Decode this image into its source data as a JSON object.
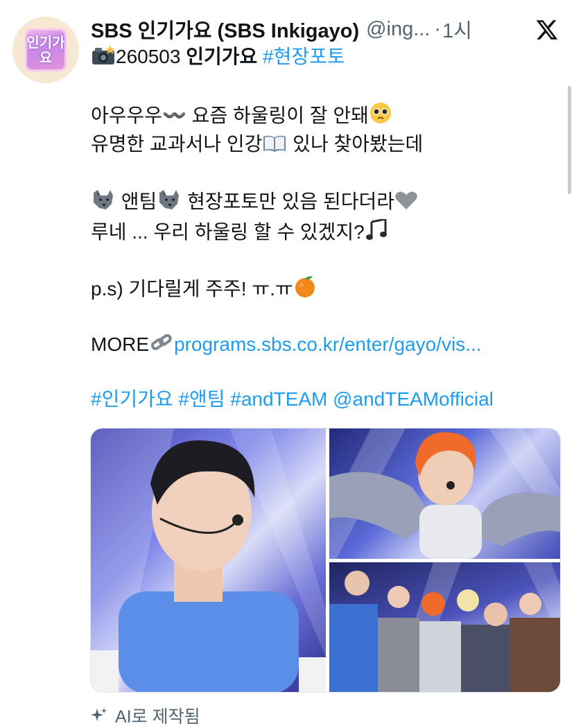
{
  "author": {
    "display_name": "SBS 인기가요 (SBS Inkigayo)",
    "handle": "@ing...",
    "separator": "·",
    "time": "1시",
    "avatar_text": "인기가요"
  },
  "tweet": {
    "line1_prefix": "260503 ",
    "line1_bold": "인기가요",
    "line1_hashtag": "#현장포토",
    "line2": "아우우우〰️ 요즘 하울링이 잘 안돼",
    "line3_a": "유명한 교과서나 인강",
    "line3_b": " 있나 찾아봤는데",
    "line4_a": " 앤팀",
    "line4_b": " 현장포토만 있음 된다더라",
    "line5": "루네 ... 우리 하울링 할 수 있겠지?",
    "line6": "p.s) 기다릴게 주주! ㅠ.ㅠ",
    "more_label": "MORE",
    "more_link": "programs.sbs.co.kr/enter/gayo/vis...",
    "tags": "#인기가요 #앤팀 #andTEAM @andTEAMofficial"
  },
  "footer": {
    "ai_label": "AI로 제작됨"
  },
  "icons": {
    "logo": "x-logo-icon",
    "camera": "camera-flash-icon",
    "wolf": "wolf-icon",
    "book": "open-book-icon",
    "heart": "grey-heart-icon",
    "notes": "music-notes-icon",
    "orange": "tangerine-icon",
    "link": "link-icon",
    "pleading": "pleading-face-icon",
    "sparkle": "sparkle-icon"
  },
  "colors": {
    "link": "#1d9bf0",
    "text": "#0f1419",
    "muted": "#536471"
  }
}
